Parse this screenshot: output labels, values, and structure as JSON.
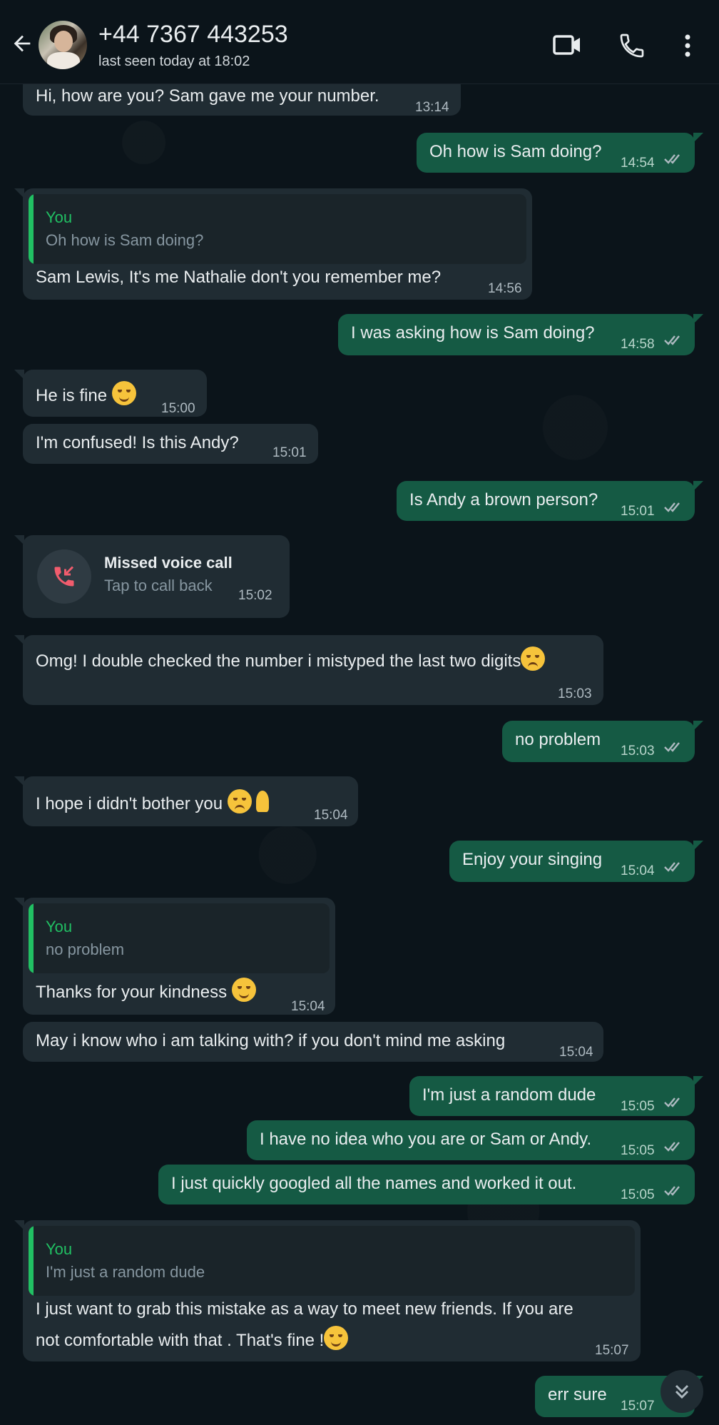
{
  "header": {
    "contact_name": "+44 7367 443253",
    "status": "last seen today at 18:02",
    "icons": [
      "back-arrow-icon",
      "video-call-icon",
      "phone-icon",
      "more-options-icon"
    ]
  },
  "colors": {
    "background": "#0b141a",
    "incoming_bubble": "#202c33",
    "outgoing_bubble": "#155a44",
    "quote_accent": "#21c063",
    "missed_call": "#f15c6d"
  },
  "messages": [
    {
      "dir": "in",
      "text": "Hi, how are you? Sam gave me your number.",
      "time": "13:14"
    },
    {
      "dir": "out",
      "text": "Oh how is Sam doing?",
      "time": "14:54"
    },
    {
      "dir": "in",
      "quote_author": "You",
      "quote_text": "Oh how is Sam doing?",
      "text": "Sam Lewis, It's me Nathalie don't you remember me?",
      "time": "14:56"
    },
    {
      "dir": "out",
      "text": "I was asking how is Sam doing?",
      "time": "14:58"
    },
    {
      "dir": "in",
      "text": "He is fine",
      "time": "15:00"
    },
    {
      "dir": "in",
      "text": "I'm confused! Is this Andy?",
      "time": "15:01"
    },
    {
      "dir": "out",
      "text": "Is Andy a brown person?",
      "time": "15:01"
    },
    {
      "dir": "in",
      "type": "missed_call",
      "title": "Missed voice call",
      "subtitle": "Tap to call back",
      "time": "15:02"
    },
    {
      "dir": "in",
      "text": "Omg! I double checked the number i mistyped the last two digits",
      "time": "15:03"
    },
    {
      "dir": "out",
      "text": "no problem",
      "time": "15:03"
    },
    {
      "dir": "in",
      "text": "I hope i didn't bother you",
      "time": "15:04"
    },
    {
      "dir": "out",
      "text": "Enjoy your singing",
      "time": "15:04"
    },
    {
      "dir": "in",
      "quote_author": "You",
      "quote_text": "no problem",
      "text": "Thanks for your kindness",
      "time": "15:04"
    },
    {
      "dir": "in",
      "text": "May i know who i am talking with? if you don't mind me asking",
      "time": "15:04"
    },
    {
      "dir": "out",
      "text": "I'm just a random dude",
      "time": "15:05"
    },
    {
      "dir": "out",
      "text": "I have no idea who you are or Sam or Andy.",
      "time": "15:05"
    },
    {
      "dir": "out",
      "text": "I just quickly googled all the names and worked it out.",
      "time": "15:05"
    },
    {
      "dir": "in",
      "quote_author": "You",
      "quote_text": "I'm just a random dude",
      "text_line1": "I just want to grab this mistake as a way to meet new friends. If you are",
      "text_line2": "not comfortable with that . That's fine !",
      "time": "15:07"
    },
    {
      "dir": "out",
      "text": "err sure",
      "time": "15:07"
    }
  ]
}
